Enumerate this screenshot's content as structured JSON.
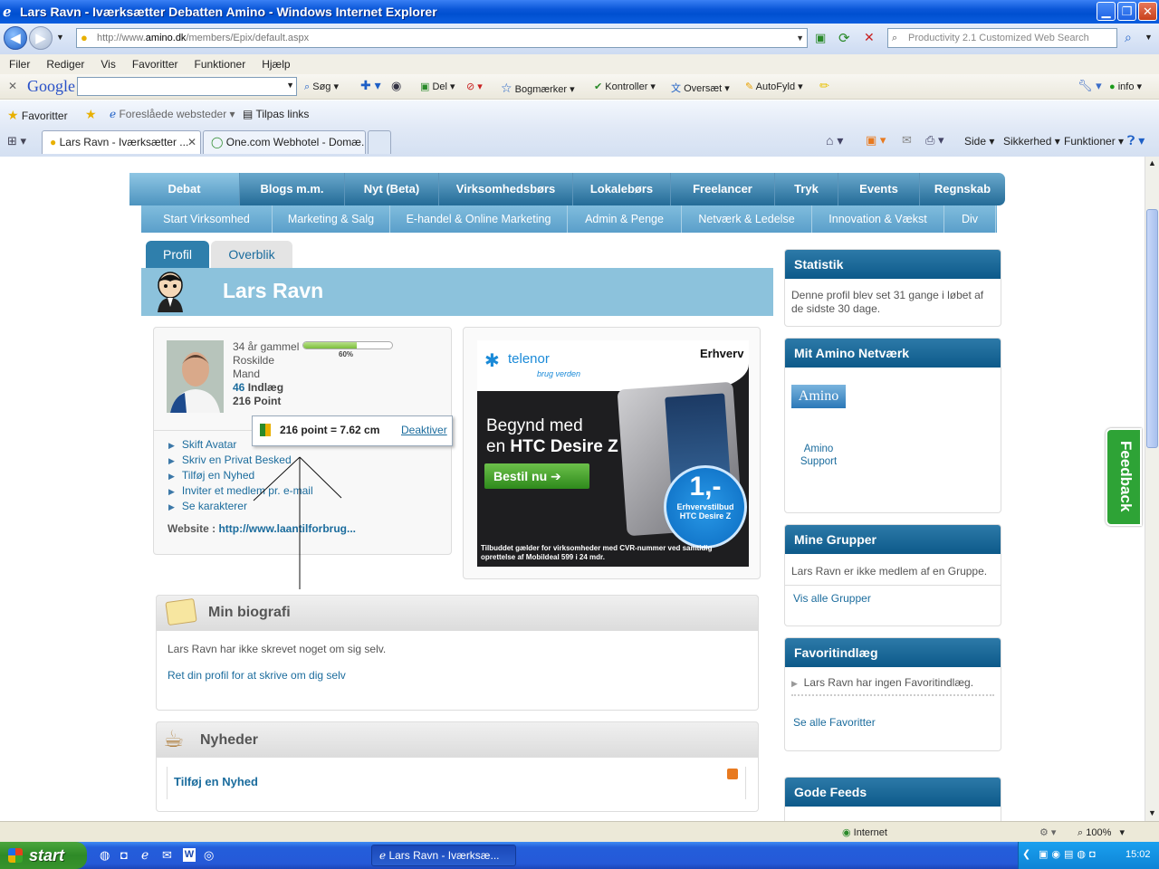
{
  "window": {
    "title": "Lars Ravn - Iværksætter Debatten Amino - Windows Internet Explorer"
  },
  "address": {
    "url_prefix": "http://www.",
    "url_domain": "amino.dk",
    "url_path": "/members/Epix/default.aspx",
    "search_placeholder": "Productivity 2.1 Customized Web Search"
  },
  "menu": [
    "Filer",
    "Rediger",
    "Vis",
    "Favoritter",
    "Funktioner",
    "Hjælp"
  ],
  "gtoolbar": {
    "logo": "Google",
    "search": "Søg",
    "del": "Del",
    "bookmarks": "Bogmærker",
    "kontroller": "Kontroller",
    "translate": "Oversæt",
    "autofill": "AutoFyld",
    "info": "info"
  },
  "favbar": {
    "favorites": "Favoritter",
    "suggested": "Foreslåede websteder",
    "customize": "Tilpas links"
  },
  "tabs": [
    {
      "label": "Lars Ravn - Iværksætter ..."
    },
    {
      "label": "One.com Webhotel - Domæ..."
    }
  ],
  "cmdbar": {
    "page": "Side",
    "security": "Sikkerhed",
    "tools": "Funktioner"
  },
  "nav_main": [
    "Debat",
    "Blogs m.m.",
    "Nyt (Beta)",
    "Virksomhedsbørs",
    "Lokalebørs",
    "Freelancer",
    "Tryk",
    "Events",
    "Regnskab"
  ],
  "nav_sub": [
    "Start Virksomhed",
    "Marketing & Salg",
    "E-handel & Online Marketing",
    "Admin & Penge",
    "Netværk & Ledelse",
    "Innovation & Vækst",
    "Div"
  ],
  "profile_tabs": [
    "Profil",
    "Overblik"
  ],
  "profile": {
    "name": "Lars Ravn",
    "age": "34 år gammel",
    "city": "Roskilde",
    "gender": "Mand",
    "posts_count": "46",
    "posts_label": "Indlæg",
    "points": "216 Point",
    "progress_label": "60%",
    "progress": 0.6,
    "actions": [
      "Skift Avatar",
      "Skriv en Privat Besked",
      "Tilføj en Nyhed",
      "Inviter et medlem pr. e-mail",
      "Se karakterer"
    ],
    "website_label": "Website :",
    "website_url": "http://www.laantilforbrug..."
  },
  "tooltip": {
    "text": "216 point = 7.62 cm",
    "action": "Deaktiver"
  },
  "ad": {
    "brand": "telenor",
    "slogan": "brug verden",
    "tag": "Erhverv",
    "line1": "Begynd med",
    "line2_prefix": "en ",
    "line2_bold": "HTC Desire Z",
    "cta": "Bestil nu",
    "price": "1,-",
    "price_sub1": "Erhvervstilbud",
    "price_sub2": "HTC Desire Z",
    "disclaimer": "Tilbuddet gælder for virksomheder med CVR-nummer ved samtidig oprettelse af Mobildeal 599 i 24 mdr."
  },
  "bio": {
    "title": "Min biografi",
    "text": "Lars Ravn har ikke skrevet noget om sig selv.",
    "link": "Ret din profil for at skrive om dig selv"
  },
  "news": {
    "title": "Nyheder",
    "link": "Tilføj en Nyhed"
  },
  "sidebar": {
    "stats_title": "Statistik",
    "stats_text": "Denne profil blev set 31 gange i løbet af de sidste 30 dage.",
    "network_title": "Mit Amino Netværk",
    "network_logo": "Amino",
    "network_member": "Amino Support",
    "groups_title": "Mine Grupper",
    "groups_text": "Lars Ravn er ikke medlem af en Gruppe.",
    "groups_link": "Vis alle Grupper",
    "fav_title": "Favoritindlæg",
    "fav_text": "Lars Ravn har ingen Favoritindlæg.",
    "fav_link": "Se alle Favoritter",
    "feeds_title": "Gode Feeds"
  },
  "feedback": "Feedback",
  "status": {
    "zone": "Internet",
    "zoom": "100%"
  },
  "taskbar": {
    "start": "start",
    "task": "Lars Ravn - Iværksæ...",
    "clock": "15:02"
  }
}
